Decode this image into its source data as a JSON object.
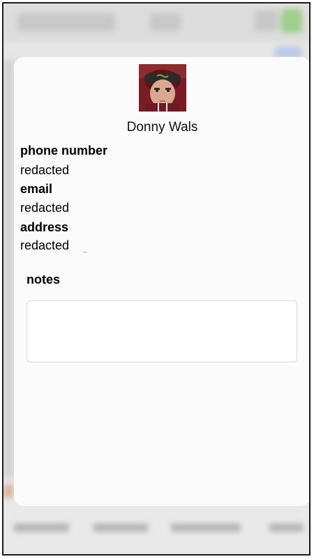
{
  "contact": {
    "name": "Donny Wals",
    "fields": [
      {
        "label": "phone number",
        "value": "redacted"
      },
      {
        "label": "email",
        "value": "redacted"
      },
      {
        "label": "address",
        "value": "redacted"
      }
    ]
  },
  "notes": {
    "label": "notes",
    "value": ""
  },
  "colors": {
    "card_background": "#fbfbfb",
    "overlay_background": "#e6e6e6",
    "text": "#000000"
  },
  "icons": {
    "avatar": "contact-photo"
  }
}
